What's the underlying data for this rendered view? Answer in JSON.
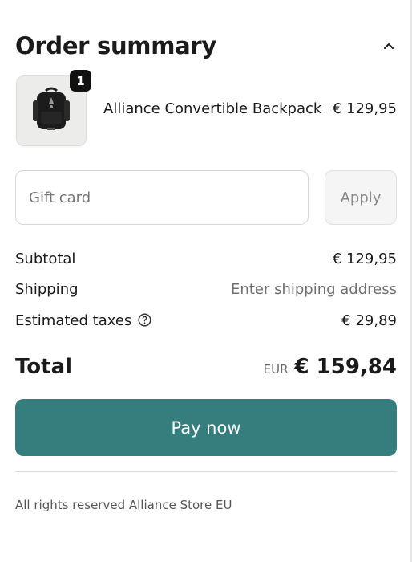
{
  "summary": {
    "title": "Order summary",
    "toggle_icon": "chevron-up-icon"
  },
  "item": {
    "quantity": "1",
    "name": "Alliance Convertible Backpack",
    "price": "€ 129,95",
    "image_icon": "backpack-image"
  },
  "gift_card": {
    "placeholder": "Gift card",
    "value": "",
    "apply_label": "Apply"
  },
  "totals": {
    "subtotal_label": "Subtotal",
    "subtotal_value": "€ 129,95",
    "shipping_label": "Shipping",
    "shipping_value": "Enter shipping address",
    "taxes_label": "Estimated taxes",
    "taxes_icon": "question-circle-icon",
    "taxes_value": "€ 29,89",
    "total_label": "Total",
    "currency": "EUR",
    "total_value": "€ 159,84"
  },
  "pay": {
    "label": "Pay now"
  },
  "footer": {
    "text": "All rights reserved Alliance Store EU"
  },
  "colors": {
    "accent": "#367e7e",
    "badge": "#111111",
    "muted_text": "#707070"
  }
}
